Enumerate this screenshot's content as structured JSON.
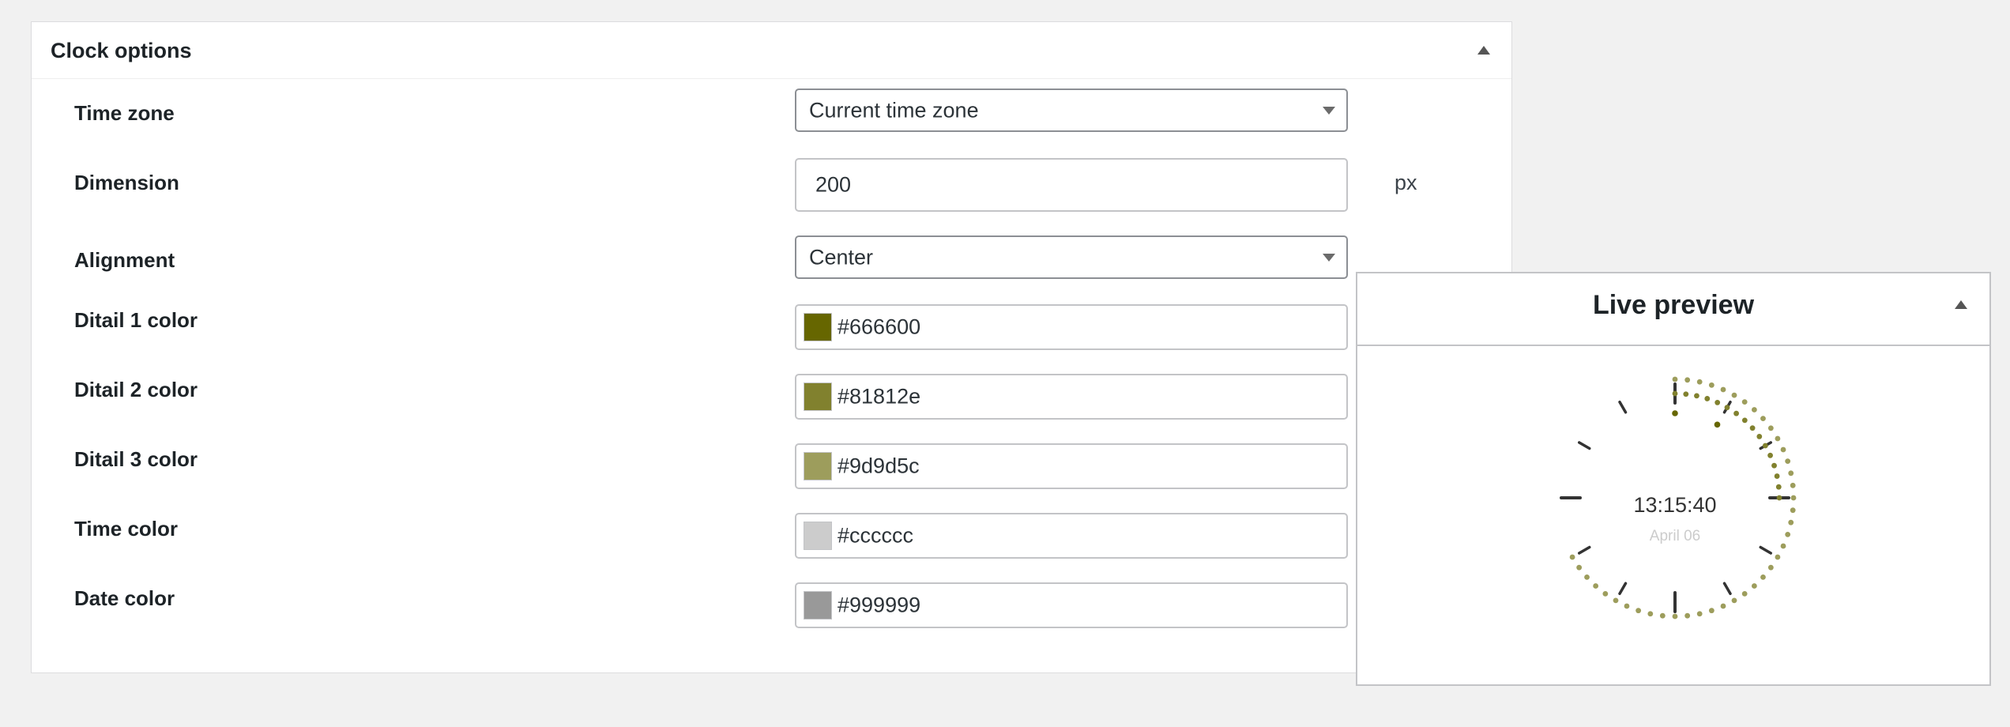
{
  "panel": {
    "title": "Clock options"
  },
  "rows": {
    "timezone": {
      "label": "Time zone",
      "value": "Current time zone"
    },
    "dimension": {
      "label": "Dimension",
      "value": "200",
      "unit": "px"
    },
    "alignment": {
      "label": "Alignment",
      "value": "Center"
    },
    "detail1": {
      "label": "Ditail 1 color",
      "value": "#666600"
    },
    "detail2": {
      "label": "Ditail 2 color",
      "value": "#81812e"
    },
    "detail3": {
      "label": "Ditail 3 color",
      "value": "#9d9d5c"
    },
    "time_color": {
      "label": "Time color",
      "value": "#cccccc"
    },
    "date_color": {
      "label": "Date color",
      "value": "#999999"
    }
  },
  "preview": {
    "title": "Live preview",
    "time": "13:15:40",
    "date": "April 06"
  },
  "colors": {
    "tick": "#333333",
    "seconds_dots": "#9d9d5c",
    "minute_dots": "#81812e",
    "hour_dot": "#666600"
  }
}
